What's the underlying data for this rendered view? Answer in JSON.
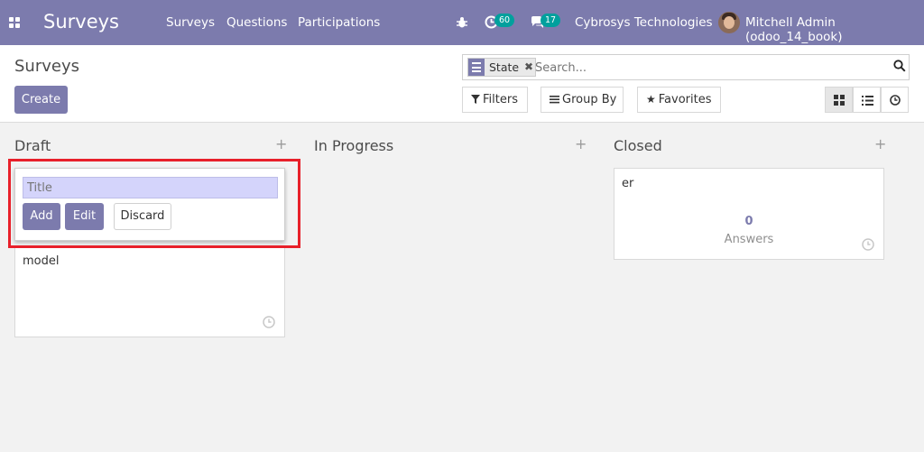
{
  "navbar": {
    "app_name": "Surveys",
    "menu": [
      "Surveys",
      "Questions",
      "Participations"
    ],
    "activity_count": "60",
    "messages_count": "17",
    "company": "Cybrosys Technologies",
    "user": "Mitchell Admin (odoo_14_book)",
    "icons": [
      "apps-grid-icon",
      "bug-icon",
      "activity-clock-icon",
      "chat-icon"
    ],
    "colors": {
      "brand": "#7c7bad",
      "badge": "#00a09d"
    }
  },
  "control_panel": {
    "breadcrumb": "Surveys",
    "create_label": "Create",
    "search": {
      "facet_label": "State",
      "placeholder": "Search..."
    },
    "filters_label": "Filters",
    "group_by_label": "Group By",
    "favorites_label": "Favorites",
    "views": [
      "kanban",
      "list",
      "activity"
    ],
    "active_view": "kanban"
  },
  "kanban": {
    "columns": [
      {
        "title": "Draft"
      },
      {
        "title": "In Progress"
      },
      {
        "title": "Closed"
      }
    ],
    "quick_create": {
      "placeholder": "Title",
      "add_label": "Add",
      "edit_label": "Edit",
      "discard_label": "Discard"
    },
    "draft_card": {
      "title": "model"
    },
    "closed_card": {
      "title": "er",
      "answers_count": "0",
      "answers_label": "Answers"
    }
  },
  "annotation": {
    "color": "#e8202a"
  }
}
